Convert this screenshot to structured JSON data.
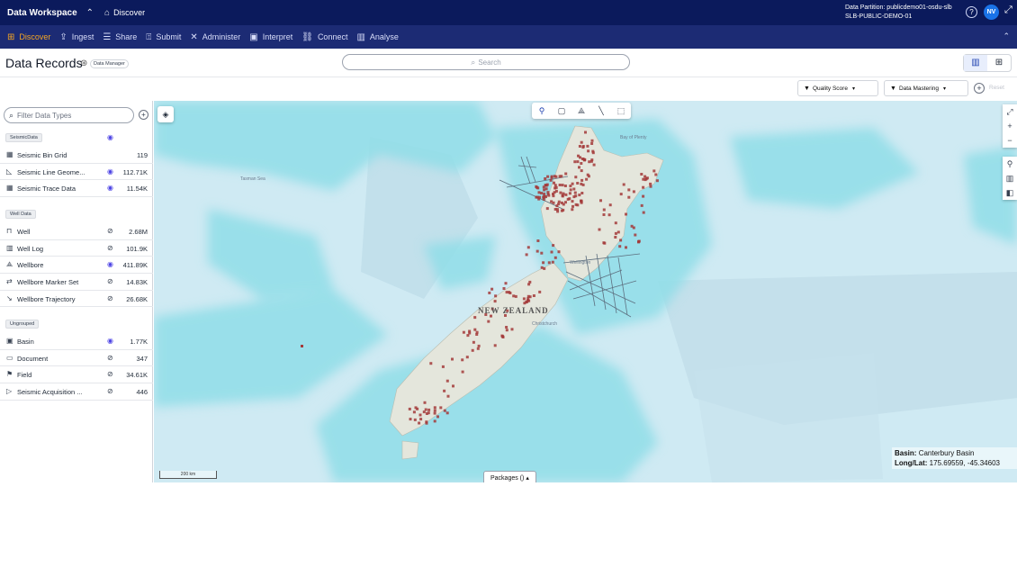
{
  "topbar": {
    "brand": "Data Workspace",
    "breadcrumb": "Discover",
    "partition_line1": "Data Partition: publicdemo01-osdu-slb",
    "partition_line2": "SLB-PUBLIC-DEMO-01",
    "avatar": "NV"
  },
  "nav": {
    "items": [
      {
        "label": "Discover",
        "icon": "grid-icon"
      },
      {
        "label": "Ingest",
        "icon": "ingest-icon"
      },
      {
        "label": "Share",
        "icon": "list-icon"
      },
      {
        "label": "Submit",
        "icon": "submit-icon"
      },
      {
        "label": "Administer",
        "icon": "tools-icon"
      },
      {
        "label": "Interpret",
        "icon": "interpret-icon"
      },
      {
        "label": "Connect",
        "icon": "connect-icon"
      },
      {
        "label": "Analyse",
        "icon": "chart-icon"
      }
    ]
  },
  "header": {
    "title": "Data Records",
    "role": "Data Manager",
    "search_placeholder": "Search"
  },
  "filters": {
    "quality_score": "Quality Score",
    "data_mastering": "Data Mastering",
    "reset": "Reset"
  },
  "sidebar": {
    "filter_placeholder": "Filter Data Types",
    "groups": [
      {
        "name": "SeismicData",
        "rows": [
          {
            "label": "Seismic Bin Grid",
            "count": "119",
            "icon": "bin-grid-icon",
            "eye": "none"
          },
          {
            "label": "Seismic Line Geome...",
            "count": "112.71K",
            "icon": "line-geometry-icon",
            "eye": "on"
          },
          {
            "label": "Seismic Trace Data",
            "count": "11.54K",
            "icon": "trace-data-icon",
            "eye": "on"
          }
        ]
      },
      {
        "name": "Well Data",
        "rows": [
          {
            "label": "Well",
            "count": "2.68M",
            "icon": "well-icon",
            "eye": "off"
          },
          {
            "label": "Well Log",
            "count": "101.9K",
            "icon": "well-log-icon",
            "eye": "off"
          },
          {
            "label": "Wellbore",
            "count": "411.89K",
            "icon": "wellbore-icon",
            "eye": "on"
          },
          {
            "label": "Wellbore Marker Set",
            "count": "14.83K",
            "icon": "marker-set-icon",
            "eye": "off"
          },
          {
            "label": "Wellbore Trajectory",
            "count": "26.68K",
            "icon": "trajectory-icon",
            "eye": "off"
          }
        ]
      },
      {
        "name": "Ungrouped",
        "rows": [
          {
            "label": "Basin",
            "count": "1.77K",
            "icon": "basin-icon",
            "eye": "on"
          },
          {
            "label": "Document",
            "count": "347",
            "icon": "document-icon",
            "eye": "off"
          },
          {
            "label": "Field",
            "count": "34.61K",
            "icon": "field-icon",
            "eye": "off"
          },
          {
            "label": "Seismic Acquisition ...",
            "count": "446",
            "icon": "acquisition-icon",
            "eye": "off"
          }
        ]
      }
    ]
  },
  "map": {
    "country_label": "NEW ZEALAND",
    "sea_label": "Tasman Sea",
    "bay_label": "Bay of Plenty",
    "city_label": "Christchurch",
    "wellington_label": "Wellington",
    "scale_label": "200 km",
    "packages_label": "Packages ()",
    "info_basin_key": "Basin:",
    "info_basin_value": "Canterbury Basin",
    "info_coords_key": "Long/Lat:",
    "info_coords_value": "175.69559, -45.34603",
    "colors": {
      "ocean": "#cfeaf3",
      "shelf": "#8fdde8",
      "land": "#e4e6dc",
      "marker": "#a33a3a"
    }
  }
}
